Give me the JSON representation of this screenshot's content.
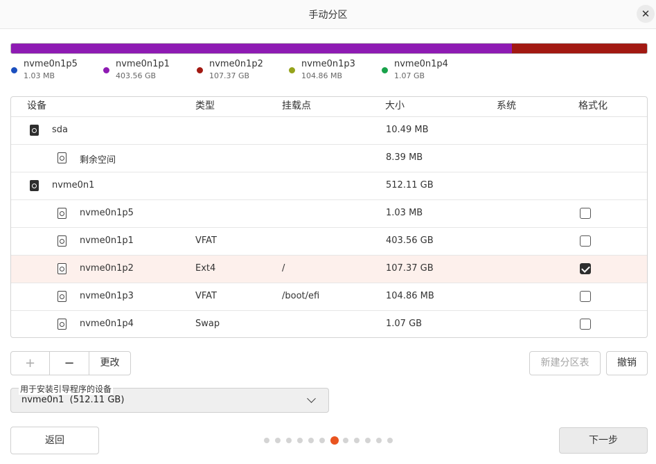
{
  "window": {
    "title": "手动分区",
    "close_icon": "✕"
  },
  "partition_bar": {
    "segments": [
      {
        "name": "nvme0n1p5",
        "color": "#1b4fbf",
        "fraction": 0.0
      },
      {
        "name": "nvme0n1p1",
        "color": "#8e1bb3",
        "fraction": 0.788
      },
      {
        "name": "nvme0n1p2",
        "color": "#a21912",
        "fraction": 0.212
      }
    ]
  },
  "legend": [
    {
      "name": "nvme0n1p5",
      "size": "1.03 MB",
      "color": "#1b4fbf"
    },
    {
      "name": "nvme0n1p1",
      "size": "403.56 GB",
      "color": "#8e1bb3"
    },
    {
      "name": "nvme0n1p2",
      "size": "107.37 GB",
      "color": "#a21912"
    },
    {
      "name": "nvme0n1p3",
      "size": "104.86 MB",
      "color": "#95a31b"
    },
    {
      "name": "nvme0n1p4",
      "size": "1.07 GB",
      "color": "#18a24a"
    }
  ],
  "table": {
    "headers": {
      "device": "设备",
      "type": "类型",
      "mount": "挂载点",
      "size": "大小",
      "system": "系统",
      "format": "格式化"
    },
    "rows": [
      {
        "device": "sda",
        "kind": "disk",
        "type": "",
        "mount": "",
        "size": "10.49 MB",
        "system": "",
        "format": null
      },
      {
        "device": "剩余空间",
        "kind": "part",
        "type": "",
        "mount": "",
        "size": "8.39 MB",
        "system": "",
        "format": null
      },
      {
        "device": "nvme0n1",
        "kind": "disk",
        "type": "",
        "mount": "",
        "size": "512.11 GB",
        "system": "",
        "format": null
      },
      {
        "device": "nvme0n1p5",
        "kind": "part",
        "type": "",
        "mount": "",
        "size": "1.03 MB",
        "system": "",
        "format": false
      },
      {
        "device": "nvme0n1p1",
        "kind": "part",
        "type": "VFAT",
        "mount": "",
        "size": "403.56 GB",
        "system": "",
        "format": false
      },
      {
        "device": "nvme0n1p2",
        "kind": "part",
        "type": "Ext4",
        "mount": "/",
        "size": "107.37 GB",
        "system": "",
        "format": true,
        "selected": true
      },
      {
        "device": "nvme0n1p3",
        "kind": "part",
        "type": "VFAT",
        "mount": "/boot/efi",
        "size": "104.86 MB",
        "system": "",
        "format": false
      },
      {
        "device": "nvme0n1p4",
        "kind": "part",
        "type": "Swap",
        "mount": "",
        "size": "1.07 GB",
        "system": "",
        "format": false
      }
    ]
  },
  "toolbar": {
    "add_label": "+",
    "remove_label": "−",
    "change_label": "更改",
    "new_table_label": "新建分区表",
    "revert_label": "撤销"
  },
  "bootloader": {
    "label": "用于安装引导程序的设备",
    "value": "nvme0n1  (512.11 GB)"
  },
  "footer": {
    "back_label": "返回",
    "next_label": "下一步",
    "step_count": 12,
    "current_step": 7
  }
}
